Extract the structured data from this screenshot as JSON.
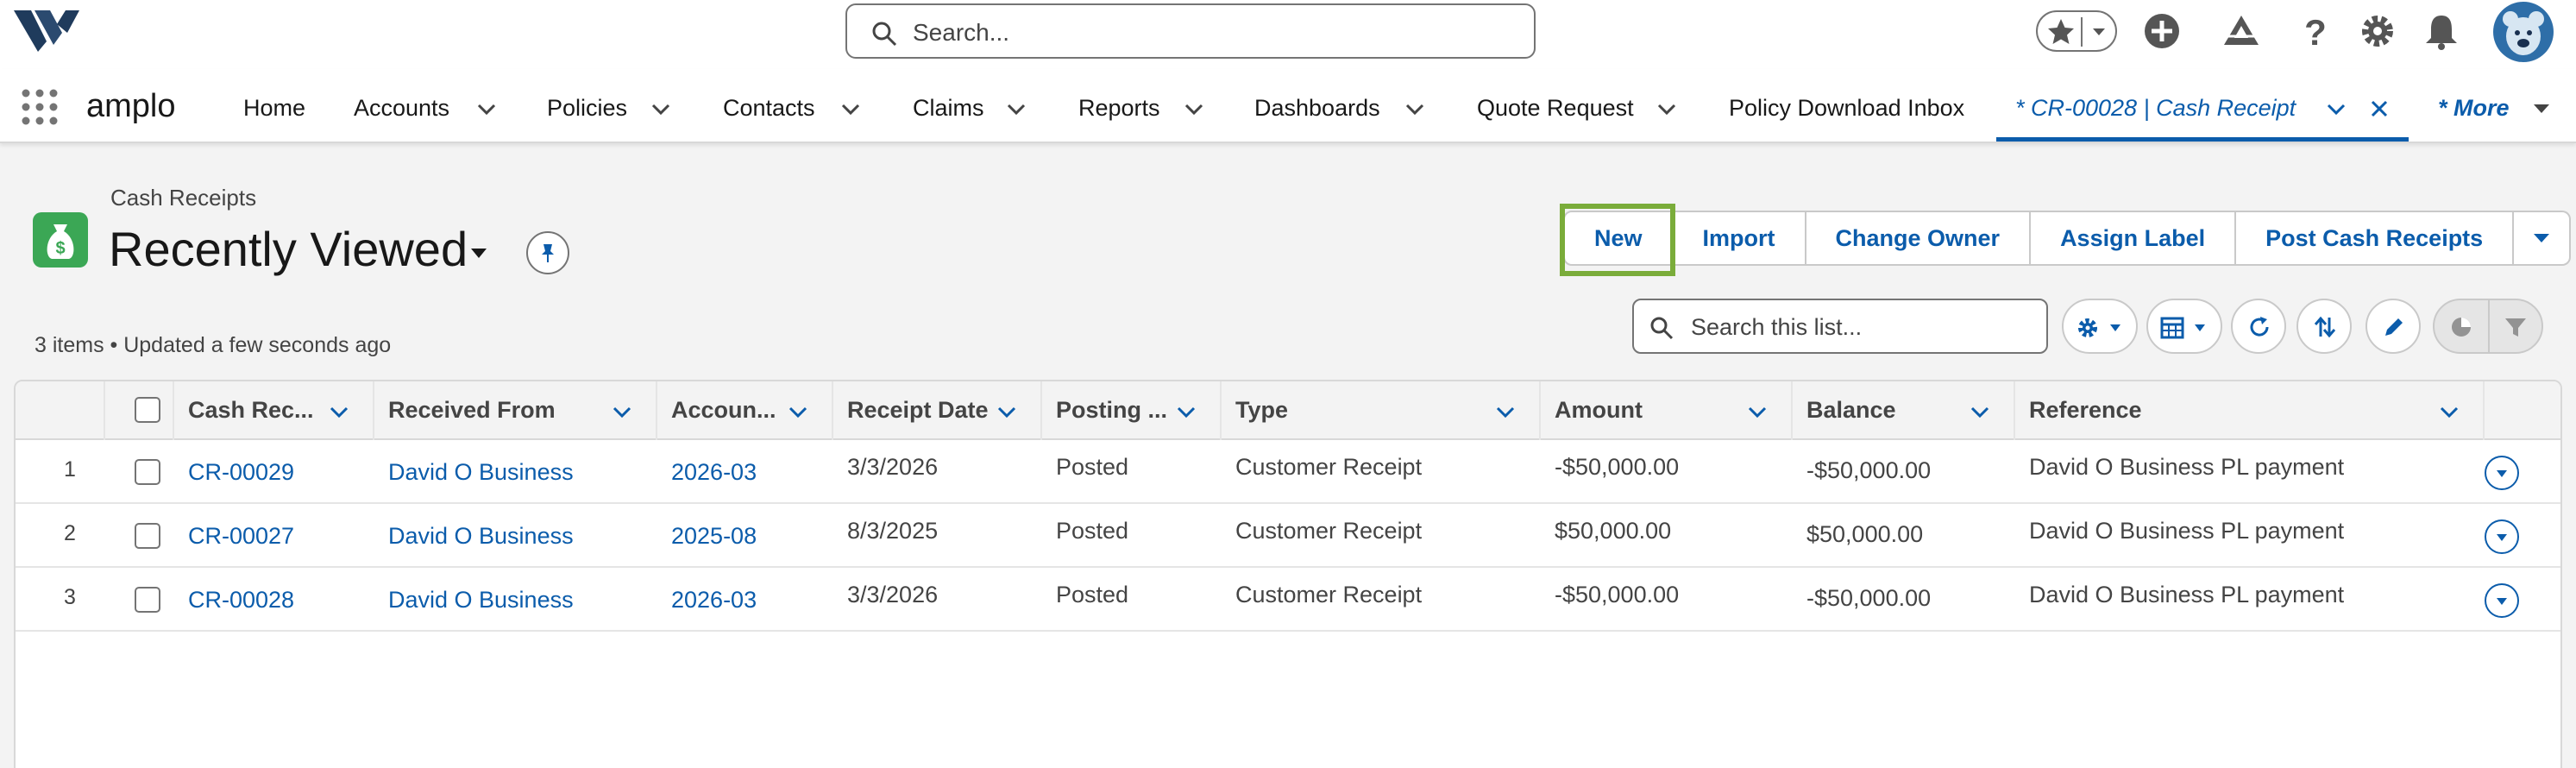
{
  "header": {
    "search_placeholder": "Search...",
    "app_name": "amplo"
  },
  "nav": {
    "items": [
      {
        "label": "Home"
      },
      {
        "label": "Accounts"
      },
      {
        "label": "Policies"
      },
      {
        "label": "Contacts"
      },
      {
        "label": "Claims"
      },
      {
        "label": "Reports"
      },
      {
        "label": "Dashboards"
      },
      {
        "label": "Quote Request"
      },
      {
        "label": "Policy Download Inbox"
      }
    ],
    "active_tab": "* CR-00028 | Cash Receipt",
    "more": "* More"
  },
  "list_view": {
    "object_label": "Cash Receipts",
    "title": "Recently Viewed",
    "status": "3 items • Updated a few seconds ago",
    "search_placeholder": "Search this list...",
    "actions": [
      "New",
      "Import",
      "Change Owner",
      "Assign Label",
      "Post Cash Receipts"
    ]
  },
  "table": {
    "columns": [
      "Cash Rec...",
      "Received From",
      "Accoun...",
      "Receipt Date",
      "Posting ...",
      "Type",
      "Amount",
      "Balance",
      "Reference"
    ],
    "rows": [
      {
        "num": "1",
        "cash_receipt": "CR-00029",
        "received_from": "David O Business",
        "accounting_period": "2026-03",
        "receipt_date": "3/3/2026",
        "posting_status": "Posted",
        "type": "Customer Receipt",
        "amount": "-$50,000.00",
        "balance": "-$50,000.00",
        "reference": "David O Business PL payment"
      },
      {
        "num": "2",
        "cash_receipt": "CR-00027",
        "received_from": "David O Business",
        "accounting_period": "2025-08",
        "receipt_date": "8/3/2025",
        "posting_status": "Posted",
        "type": "Customer Receipt",
        "amount": "$50,000.00",
        "balance": "$50,000.00",
        "reference": "David O Business PL payment"
      },
      {
        "num": "3",
        "cash_receipt": "CR-00028",
        "received_from": "David O Business",
        "accounting_period": "2026-03",
        "receipt_date": "3/3/2026",
        "posting_status": "Posted",
        "type": "Customer Receipt",
        "amount": "-$50,000.00",
        "balance": "-$50,000.00",
        "reference": "David O Business PL payment"
      }
    ]
  },
  "colors": {
    "brand_blue": "#0b5cab",
    "object_icon_green": "#3ba755",
    "highlight_green": "#7aac3a"
  },
  "icons": [
    "app-logo-icon",
    "search-icon",
    "favorites-star-icon",
    "chevron-down-icon",
    "global-add-icon",
    "trailhead-icon",
    "help-icon",
    "setup-gear-icon",
    "notifications-bell-icon",
    "avatar",
    "app-launcher-icon",
    "close-icon",
    "money-bag-icon",
    "pin-icon",
    "settings-gear-icon",
    "table-view-icon",
    "refresh-icon",
    "sort-icon",
    "edit-pencil-icon",
    "chart-icon",
    "filter-icon"
  ]
}
